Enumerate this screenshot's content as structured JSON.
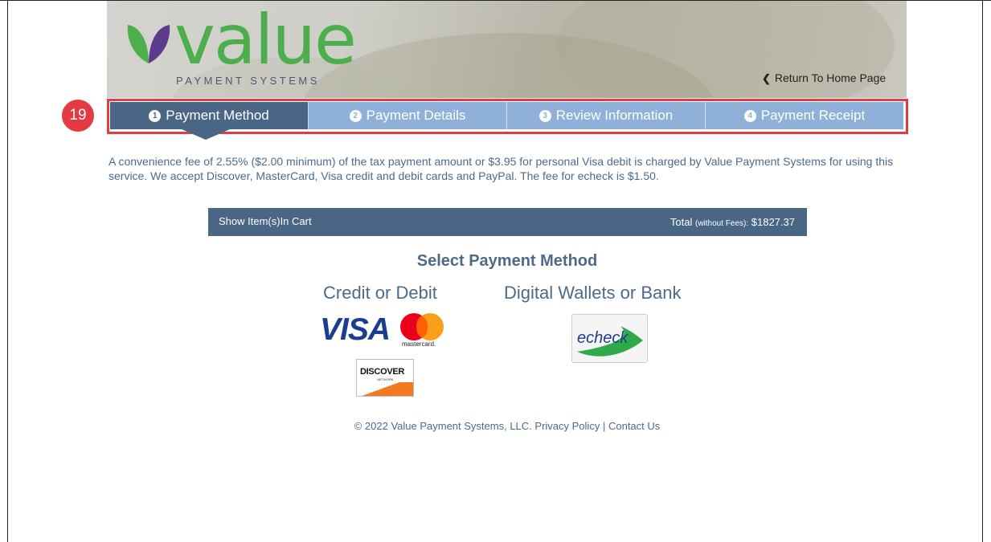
{
  "header": {
    "logo_word": "value",
    "logo_sub": "PAYMENT SYSTEMS",
    "return_link": "Return To Home Page"
  },
  "annotation_badge": "19",
  "steps": [
    {
      "num": "1",
      "label": "Payment Method",
      "active": true
    },
    {
      "num": "2",
      "label": "Payment Details",
      "active": false
    },
    {
      "num": "3",
      "label": "Review Information",
      "active": false
    },
    {
      "num": "4",
      "label": "Payment Receipt",
      "active": false
    }
  ],
  "fee_notice": "A convenience fee of 2.55% ($2.00 minimum) of the tax payment amount or $3.95 for personal Visa debit is charged by Value Payment Systems for using this service. We accept Discover, MasterCard, Visa credit and debit cards and PayPal. The fee for echeck is $1.50.",
  "cart": {
    "show_label": "Show Item(s)In Cart",
    "total_label": "Total",
    "total_note": "(without Fees):",
    "total_value": "$1827.37"
  },
  "payment": {
    "title": "Select Payment Method",
    "credit_heading": "Credit or Debit",
    "wallet_heading": "Digital Wallets or Bank",
    "visa_label": "VISA",
    "mastercard_label": "mastercard.",
    "discover_label": "DISCOVER",
    "discover_sub": "NETWORK",
    "echeck_label": "echeck"
  },
  "footer": {
    "copyright": "© 2022 Value Payment Systems, LLC.",
    "privacy": "Privacy Policy",
    "separator": "|",
    "contact": "Contact Us"
  },
  "colors": {
    "brand_green": "#4cae4c",
    "nav_active": "#4a6685",
    "nav_inactive": "#8fb1d9",
    "highlight_red": "#e53a42",
    "text_blue": "#4d6a8a"
  }
}
